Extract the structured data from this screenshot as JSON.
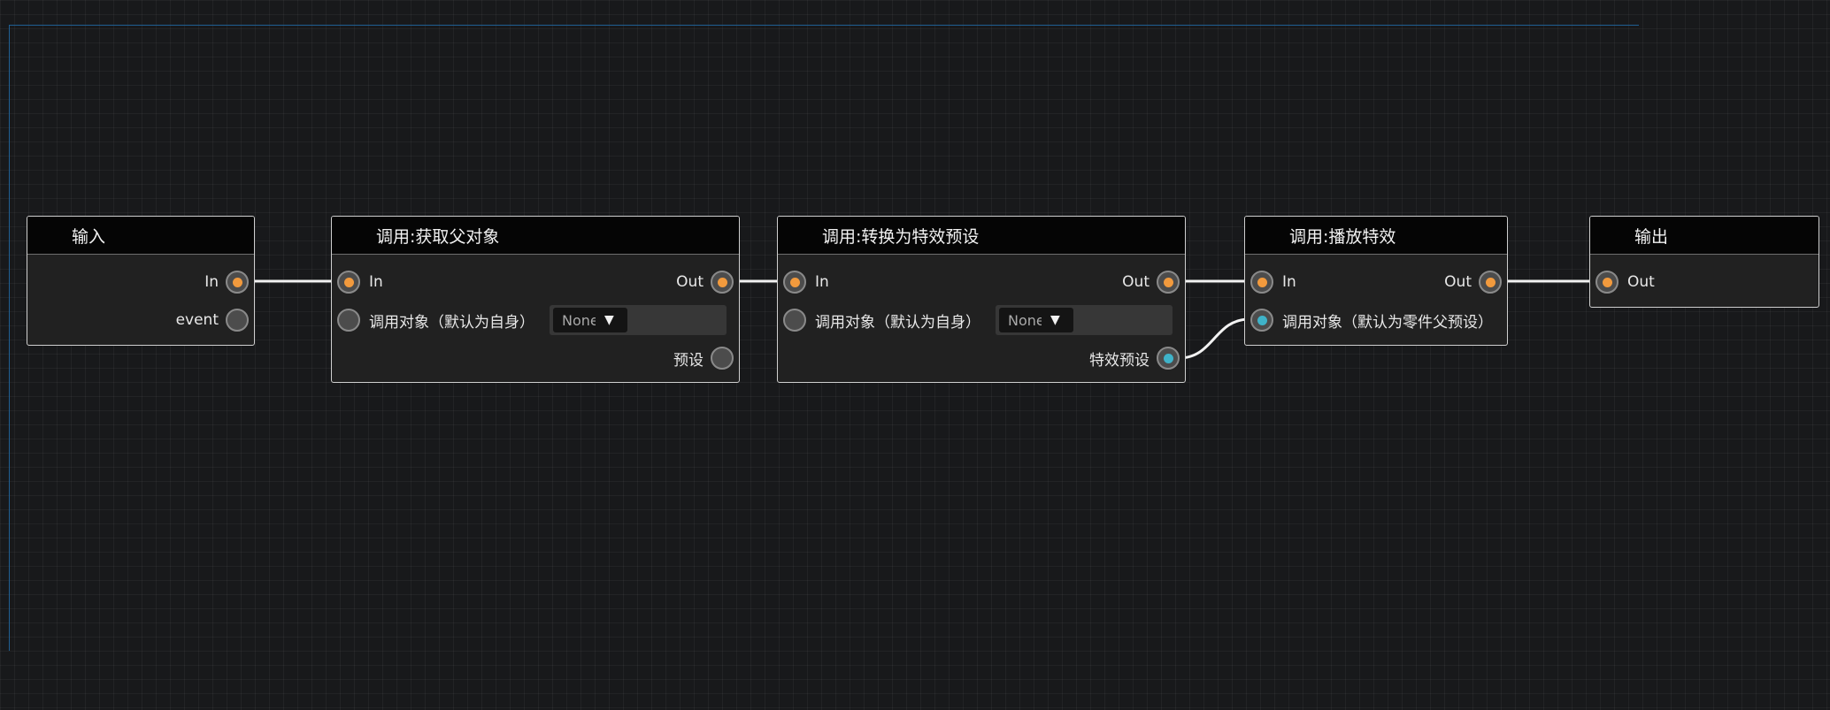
{
  "nodes": {
    "input": {
      "title": "输入",
      "in_label": "In",
      "event_label": "event"
    },
    "get_parent": {
      "title": "调用:获取父对象",
      "in_label": "In",
      "out_label": "Out",
      "target_label": "调用对象（默认为自身）",
      "target_value": "None",
      "result_label": "预设"
    },
    "to_effect": {
      "title": "调用:转换为特效预设",
      "in_label": "In",
      "out_label": "Out",
      "target_label": "调用对象（默认为自身）",
      "target_value": "None",
      "result_label": "特效预设"
    },
    "play_effect": {
      "title": "调用:播放特效",
      "in_label": "In",
      "out_label": "Out",
      "target_label": "调用对象（默认为零件父预设）"
    },
    "output": {
      "title": "输出",
      "out_label": "Out"
    }
  },
  "colors": {
    "exec_port": "#f29a3d",
    "data_port": "#3fb3c9",
    "wire": "#f2f2f2",
    "frame": "#1f5f93"
  },
  "icons": {
    "dropdown_arrow": "▼"
  }
}
